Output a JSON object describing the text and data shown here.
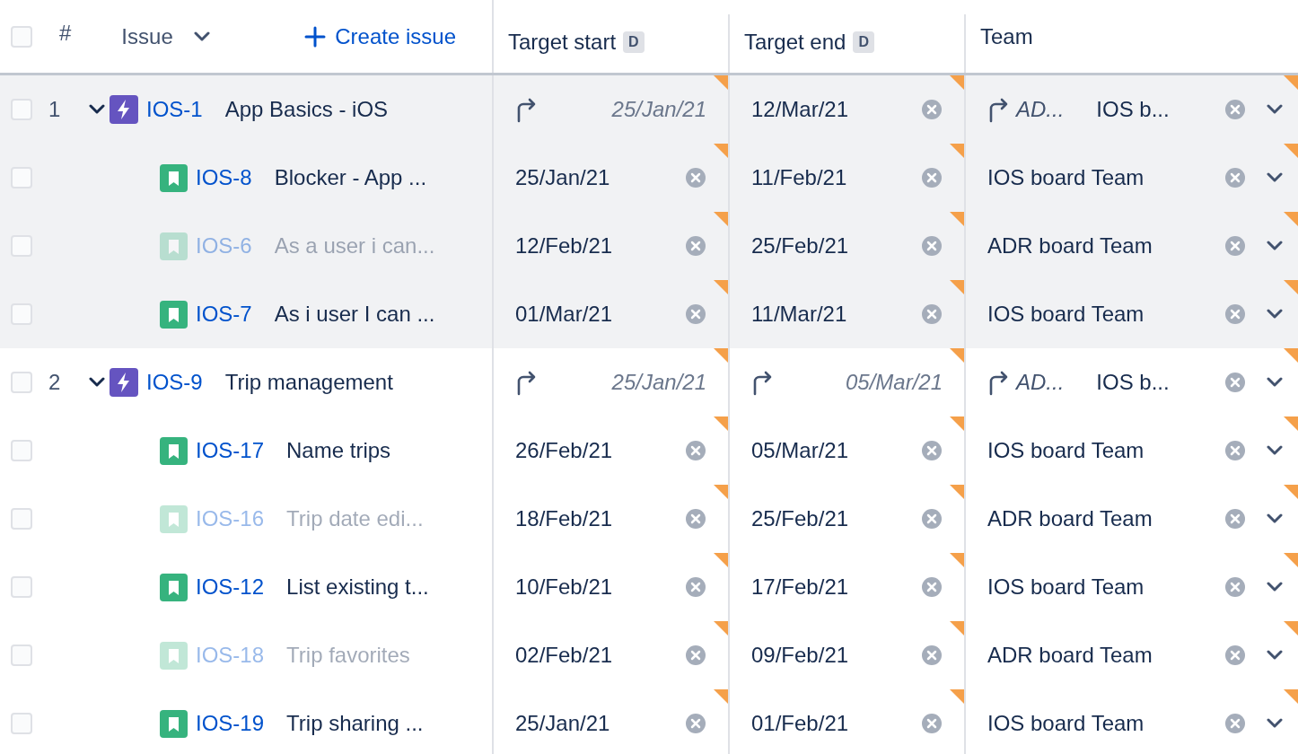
{
  "header": {
    "checked": false,
    "number": "#",
    "issue": "Issue",
    "create": "Create issue",
    "start": "Target start",
    "start_badge": "D",
    "end": "Target end",
    "end_badge": "D",
    "team": "Team"
  },
  "rows": [
    {
      "kind": "epic",
      "checked": false,
      "number": "1",
      "expanded": true,
      "key": "IOS-1",
      "summary": "App Basics - iOS",
      "muted": false,
      "highlighted": true,
      "start": {
        "kind": "rollup",
        "text": "25/Jan/21"
      },
      "end": {
        "kind": "value",
        "text": "12/Mar/21"
      },
      "team": {
        "kind": "rollup",
        "from": "AD...",
        "text": "IOS b..."
      }
    },
    {
      "kind": "story",
      "checked": false,
      "key": "IOS-8",
      "summary": "Blocker - App ...",
      "muted": false,
      "highlighted": true,
      "start": {
        "kind": "value",
        "text": "25/Jan/21"
      },
      "end": {
        "kind": "value",
        "text": "11/Feb/21"
      },
      "team": {
        "kind": "value",
        "text": "IOS board Team"
      }
    },
    {
      "kind": "story",
      "checked": false,
      "key": "IOS-6",
      "summary": "As a user i can...",
      "muted": true,
      "highlighted": true,
      "start": {
        "kind": "value",
        "text": "12/Feb/21"
      },
      "end": {
        "kind": "value",
        "text": "25/Feb/21"
      },
      "team": {
        "kind": "value",
        "text": "ADR board Team"
      }
    },
    {
      "kind": "story",
      "checked": false,
      "key": "IOS-7",
      "summary": "As i user I can ...",
      "muted": false,
      "highlighted": true,
      "start": {
        "kind": "value",
        "text": "01/Mar/21"
      },
      "end": {
        "kind": "value",
        "text": "11/Mar/21"
      },
      "team": {
        "kind": "value",
        "text": "IOS board Team"
      }
    },
    {
      "kind": "epic",
      "checked": false,
      "number": "2",
      "expanded": true,
      "key": "IOS-9",
      "summary": "Trip management",
      "muted": false,
      "highlighted": false,
      "start": {
        "kind": "rollup",
        "text": "25/Jan/21"
      },
      "end": {
        "kind": "rollup",
        "text": "05/Mar/21"
      },
      "team": {
        "kind": "rollup",
        "from": "AD...",
        "text": "IOS b..."
      }
    },
    {
      "kind": "story",
      "checked": false,
      "key": "IOS-17",
      "summary": "Name trips",
      "muted": false,
      "highlighted": false,
      "start": {
        "kind": "value",
        "text": "26/Feb/21"
      },
      "end": {
        "kind": "value",
        "text": "05/Mar/21"
      },
      "team": {
        "kind": "value",
        "text": "IOS board Team"
      }
    },
    {
      "kind": "story",
      "checked": false,
      "key": "IOS-16",
      "summary": "Trip date edi...",
      "muted": true,
      "highlighted": false,
      "start": {
        "kind": "value",
        "text": "18/Feb/21"
      },
      "end": {
        "kind": "value",
        "text": "25/Feb/21"
      },
      "team": {
        "kind": "value",
        "text": "ADR board Team"
      }
    },
    {
      "kind": "story",
      "checked": false,
      "key": "IOS-12",
      "summary": "List existing t...",
      "muted": false,
      "highlighted": false,
      "start": {
        "kind": "value",
        "text": "10/Feb/21"
      },
      "end": {
        "kind": "value",
        "text": "17/Feb/21"
      },
      "team": {
        "kind": "value",
        "text": "IOS board Team"
      }
    },
    {
      "kind": "story",
      "checked": false,
      "key": "IOS-18",
      "summary": "Trip favorites",
      "muted": true,
      "highlighted": false,
      "start": {
        "kind": "value",
        "text": "02/Feb/21"
      },
      "end": {
        "kind": "value",
        "text": "09/Feb/21"
      },
      "team": {
        "kind": "value",
        "text": "ADR board Team"
      }
    },
    {
      "kind": "story",
      "checked": false,
      "key": "IOS-19",
      "summary": "Trip sharing ...",
      "muted": false,
      "highlighted": false,
      "start": {
        "kind": "value",
        "text": "25/Jan/21"
      },
      "end": {
        "kind": "value",
        "text": "01/Feb/21"
      },
      "team": {
        "kind": "value",
        "text": "IOS board Team"
      }
    }
  ]
}
